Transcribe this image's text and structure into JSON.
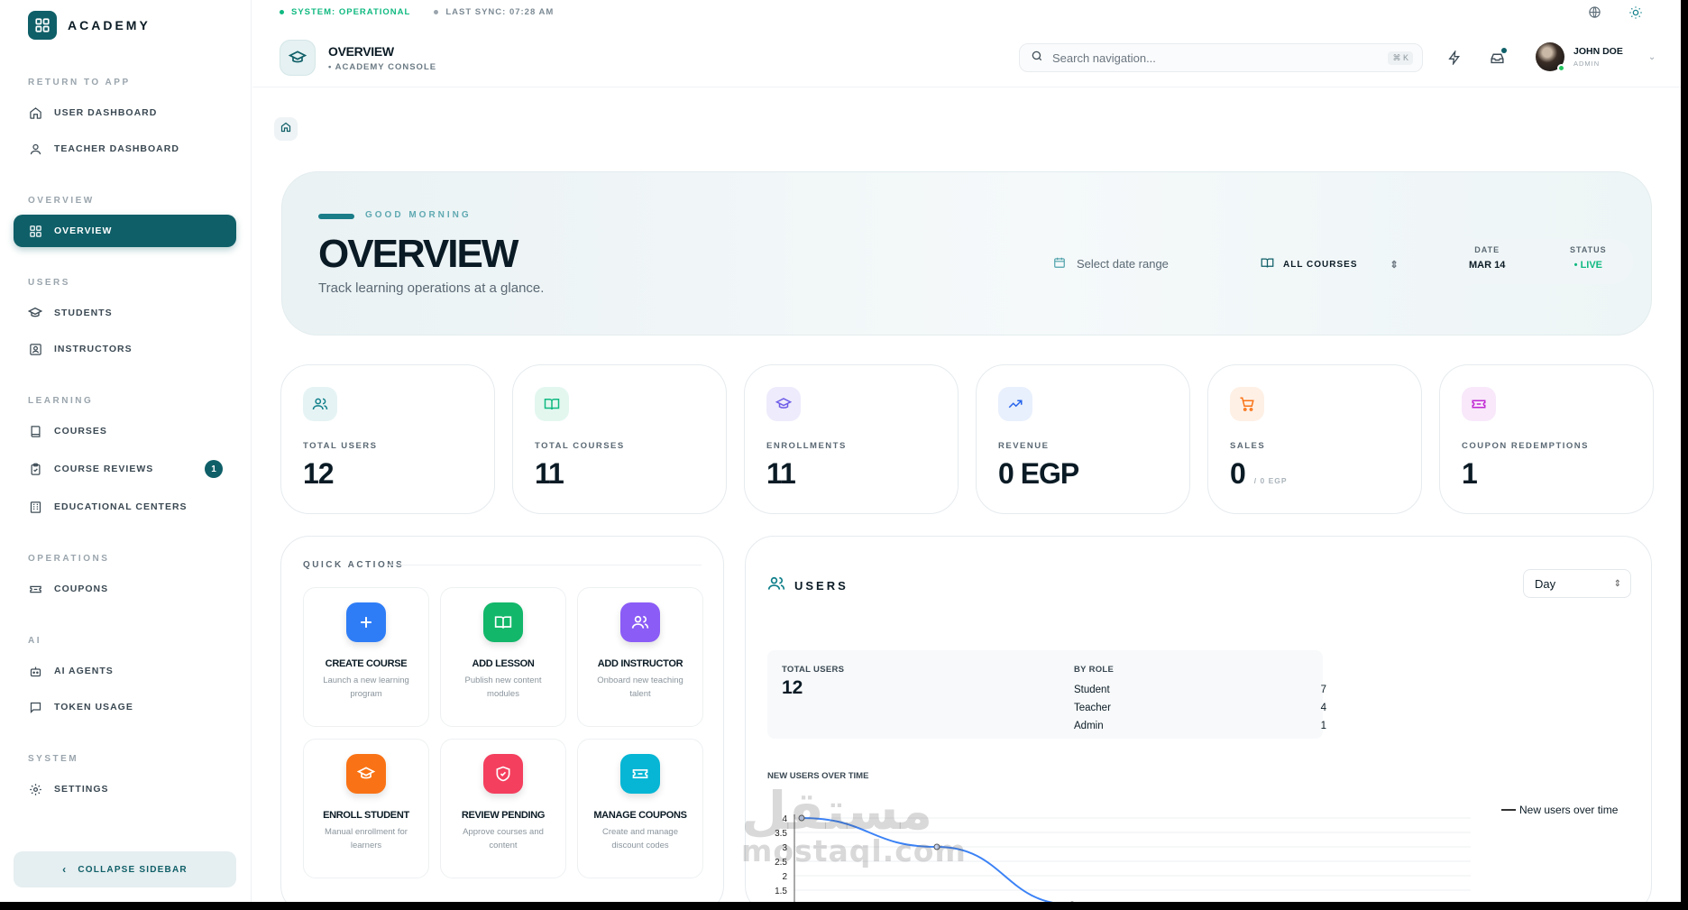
{
  "brand": {
    "name": "ACADEMY"
  },
  "sidebar": {
    "sections": [
      {
        "label": "RETURN TO APP",
        "items": [
          {
            "label": "USER DASHBOARD",
            "icon": "home-icon"
          },
          {
            "label": "TEACHER DASHBOARD",
            "icon": "user-icon"
          }
        ]
      },
      {
        "label": "OVERVIEW",
        "items": [
          {
            "label": "OVERVIEW",
            "icon": "grid-icon",
            "active": true
          }
        ]
      },
      {
        "label": "USERS",
        "items": [
          {
            "label": "STUDENTS",
            "icon": "graduation-cap-icon"
          },
          {
            "label": "INSTRUCTORS",
            "icon": "id-card-icon"
          }
        ]
      },
      {
        "label": "LEARNING",
        "items": [
          {
            "label": "COURSES",
            "icon": "book-icon"
          },
          {
            "label": "COURSE REVIEWS",
            "icon": "clipboard-check-icon",
            "badge": "1"
          },
          {
            "label": "EDUCATIONAL CENTERS",
            "icon": "building-icon"
          }
        ]
      },
      {
        "label": "OPERATIONS",
        "items": [
          {
            "label": "COUPONS",
            "icon": "ticket-icon"
          }
        ]
      },
      {
        "label": "AI",
        "items": [
          {
            "label": "AI AGENTS",
            "icon": "bot-icon"
          },
          {
            "label": "TOKEN USAGE",
            "icon": "message-square-icon"
          }
        ]
      },
      {
        "label": "SYSTEM",
        "items": [
          {
            "label": "SETTINGS",
            "icon": "gear-icon"
          }
        ]
      }
    ],
    "collapse_label": "COLLAPSE SIDEBAR"
  },
  "topbar": {
    "system_status": "SYSTEM: OPERATIONAL",
    "last_sync": "LAST SYNC: 07:28 AM",
    "status_color": "#10b981"
  },
  "header": {
    "title": "OVERVIEW",
    "subtitle": "• ACADEMY CONSOLE",
    "search_placeholder": "Search navigation...",
    "search_shortcut": "⌘ K",
    "user_name": "JOHN DOE",
    "user_role": "ADMIN"
  },
  "hero": {
    "greeting": "GOOD MORNING",
    "title": "OVERVIEW",
    "subtitle": "Track learning operations at a glance.",
    "date_range_placeholder": "Select date range",
    "course_filter": "ALL COURSES",
    "date_label": "DATE",
    "date_value": "MAR 14",
    "status_label": "STATUS",
    "status_value": "• LIVE"
  },
  "stats": [
    {
      "label": "TOTAL USERS",
      "value": "12",
      "sub": "",
      "icon": "users-icon",
      "color": "#0f7f8a",
      "bg": "#e6f3f4"
    },
    {
      "label": "TOTAL COURSES",
      "value": "11",
      "sub": "",
      "icon": "book-open-icon",
      "color": "#10b981",
      "bg": "#e3f7ef"
    },
    {
      "label": "ENROLLMENTS",
      "value": "11",
      "sub": "",
      "icon": "graduation-cap-icon",
      "color": "#6d5ce7",
      "bg": "#eeebfc"
    },
    {
      "label": "REVENUE",
      "value": "0 EGP",
      "sub": "",
      "icon": "trending-up-icon",
      "color": "#2563eb",
      "bg": "#e8f0fd"
    },
    {
      "label": "SALES",
      "value": "0",
      "sub": "/ 0 EGP",
      "icon": "cart-icon",
      "color": "#f97316",
      "bg": "#fef0e5"
    },
    {
      "label": "COUPON REDEMPTIONS",
      "value": "1",
      "sub": "",
      "icon": "ticket-icon",
      "color": "#c026d3",
      "bg": "#f8e8fa"
    }
  ],
  "quick_actions": {
    "title": "QUICK ACTIONS",
    "items": [
      {
        "title": "CREATE COURSE",
        "desc": "Launch a new learning program",
        "icon": "plus-icon",
        "color": "#2f7df6"
      },
      {
        "title": "ADD LESSON",
        "desc": "Publish new content modules",
        "icon": "book-open-icon",
        "color": "#12b76a"
      },
      {
        "title": "ADD INSTRUCTOR",
        "desc": "Onboard new teaching talent",
        "icon": "users-icon",
        "color": "#8b5cf6"
      },
      {
        "title": "ENROLL STUDENT",
        "desc": "Manual enrollment for learners",
        "icon": "graduation-cap-icon",
        "color": "#f97316"
      },
      {
        "title": "REVIEW PENDING",
        "desc": "Approve courses and content",
        "icon": "shield-check-icon",
        "color": "#f43f5e"
      },
      {
        "title": "MANAGE COUPONS",
        "desc": "Create and manage discount codes",
        "icon": "ticket-icon",
        "color": "#06b6d4"
      }
    ]
  },
  "users_panel": {
    "title": "USERS",
    "period": "Day",
    "total_label": "TOTAL USERS",
    "total_value": "12",
    "by_role_label": "BY ROLE",
    "roles": [
      {
        "name": "Student",
        "count": "7"
      },
      {
        "name": "Teacher",
        "count": "4"
      },
      {
        "name": "Admin",
        "count": "1"
      }
    ],
    "chart_title": "NEW USERS OVER TIME",
    "legend_label": "New users over time"
  },
  "chart_data": {
    "type": "line",
    "title": "NEW USERS OVER TIME",
    "series": [
      {
        "name": "New users over time",
        "values": [
          4,
          3,
          1
        ]
      }
    ],
    "y_ticks": [
      "4",
      "3.5",
      "3",
      "2.5",
      "2",
      "1.5"
    ],
    "ylim": [
      1.5,
      4
    ],
    "grid": true,
    "legend": "top-right",
    "color": "#3b82f6"
  },
  "watermark": {
    "arabic": "مستقل",
    "latin": "mostaql.com"
  }
}
